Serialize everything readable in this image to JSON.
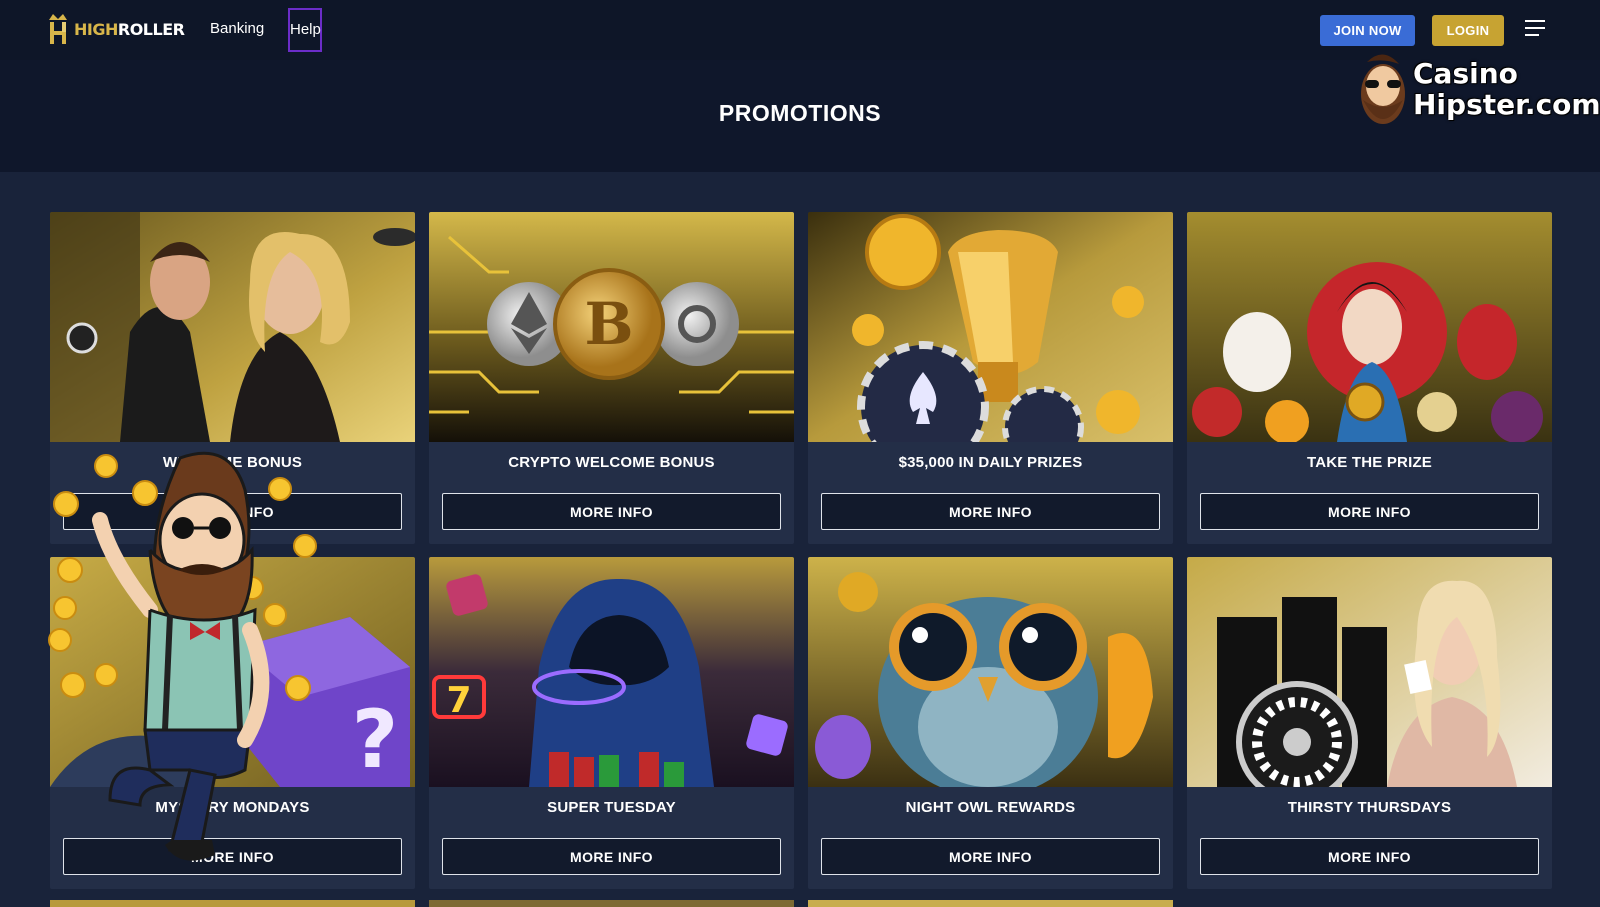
{
  "header": {
    "logo_high": "HIGH",
    "logo_roller": "ROLLER",
    "nav": [
      "Banking",
      "Help"
    ],
    "join_label": "JOIN NOW",
    "login_label": "LOGIN"
  },
  "hero": {
    "title": "PROMOTIONS"
  },
  "watermark": {
    "line1": "Casino",
    "line2": "Hipster.com"
  },
  "promotions": [
    {
      "title": "WELCOME BONUS",
      "button": "MORE INFO",
      "art": "couple"
    },
    {
      "title": "CRYPTO WELCOME BONUS",
      "button": "MORE INFO",
      "art": "crypto"
    },
    {
      "title": "$35,000 IN DAILY PRIZES",
      "button": "MORE INFO",
      "art": "trophy"
    },
    {
      "title": "TAKE THE PRIZE",
      "button": "MORE INFO",
      "art": "asian"
    },
    {
      "title": "MYSTERY MONDAYS",
      "button": "MORE INFO",
      "art": "mystery"
    },
    {
      "title": "SUPER TUESDAY",
      "button": "MORE INFO",
      "art": "hoodie"
    },
    {
      "title": "NIGHT OWL REWARDS",
      "button": "MORE INFO",
      "art": "owl"
    },
    {
      "title": "THIRSTY THURSDAYS",
      "button": "MORE INFO",
      "art": "roulette"
    }
  ],
  "colors": {
    "bg": "#19233a",
    "header": "#0e1628",
    "card": "#232e47",
    "join": "#3a6cd6",
    "login": "#c7a332",
    "gold": "#d8b64a"
  }
}
